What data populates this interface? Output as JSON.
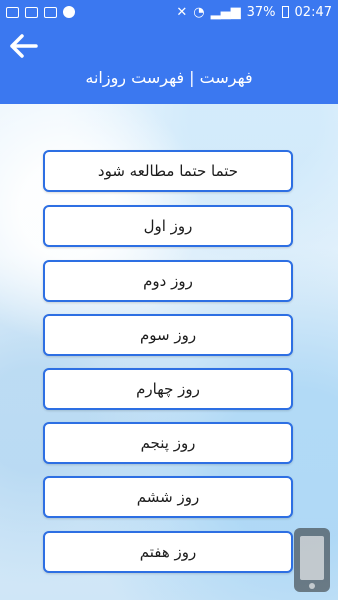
{
  "status_bar": {
    "battery": "37%",
    "time": "02:47"
  },
  "header": {
    "title": "فهرست | فهرست روزانه"
  },
  "menu": {
    "items": [
      {
        "label": "حتما حتما مطالعه شود"
      },
      {
        "label": "روز اول"
      },
      {
        "label": "روز دوم"
      },
      {
        "label": "روز سوم"
      },
      {
        "label": "روز چهارم"
      },
      {
        "label": "روز پنجم"
      },
      {
        "label": "روز ششم"
      },
      {
        "label": "روز هفتم"
      }
    ]
  },
  "colors": {
    "primary": "#3b78f0",
    "button_border": "#2d6fe3"
  },
  "icons": {
    "back": "arrow-left-icon"
  }
}
